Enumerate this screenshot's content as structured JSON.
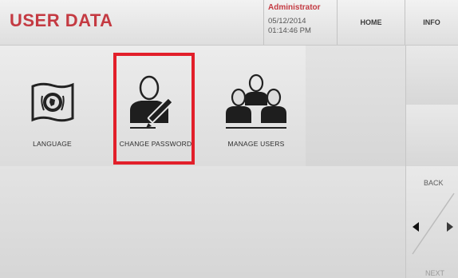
{
  "header": {
    "title": "USER DATA",
    "user_role": "Administrator",
    "date": "05/12/2014",
    "time": "01:14:46 PM",
    "home_label": "HOME",
    "info_label": "INFO"
  },
  "tiles": {
    "language": {
      "label": "LANGUAGE",
      "icon": "un-flag-icon"
    },
    "change_password": {
      "label": "CHANGE PASSWORD",
      "icon": "user-pencil-icon"
    },
    "manage_users": {
      "label": "MANAGE USERS",
      "icon": "user-group-icon"
    }
  },
  "side": {
    "back_label": "BACK",
    "next_label": "NEXT"
  },
  "colors": {
    "title": "#c43a42",
    "highlight": "#e21f2a"
  }
}
